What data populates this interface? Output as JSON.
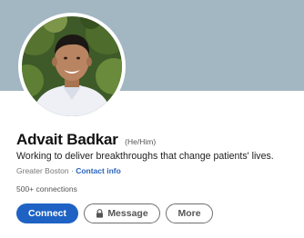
{
  "profile": {
    "name": "Advait Badkar",
    "pronouns": "(He/Him)",
    "headline": "Working to deliver breakthroughs that change patients' lives.",
    "location": "Greater Boston",
    "separator": " · ",
    "contact_info": "Contact info",
    "connections": "500+ connections"
  },
  "actions": {
    "connect_label": "Connect",
    "message_label": "Message",
    "more_label": "More"
  },
  "icons": {
    "message": "lock-icon"
  },
  "colors": {
    "banner": "#a3b7c2",
    "primary": "#1e62c4",
    "link": "#2a64bd"
  }
}
